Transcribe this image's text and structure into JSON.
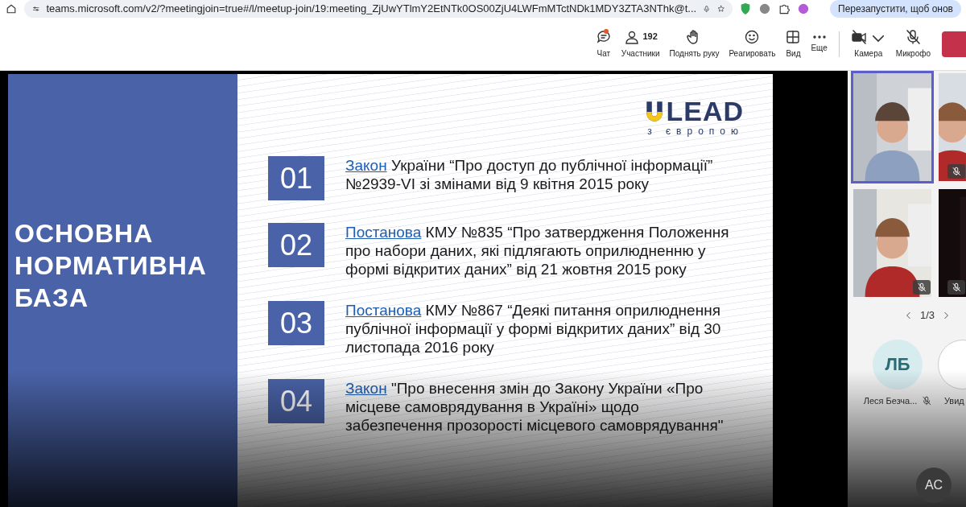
{
  "browser": {
    "url": "teams.microsoft.com/v2/?meetingjoin=true#/l/meetup-join/19:meeting_ZjUwYTlmY2EtNTk0OS00ZjU4LWFmMTctNDk1MDY3ZTA3NThk@t...",
    "restart_button": "Перезапустити, щоб онов"
  },
  "toolbar": {
    "buttons": [
      {
        "kind": "chat",
        "label": "Чат",
        "unread": true
      },
      {
        "kind": "people",
        "label": "Участники",
        "count": "192"
      },
      {
        "kind": "hand",
        "label": "Поднять руку"
      },
      {
        "kind": "react",
        "label": "Реагировать"
      },
      {
        "kind": "view",
        "label": "Вид"
      },
      {
        "kind": "more",
        "label": "Еще"
      },
      {
        "kind": "camera",
        "label": "Камера",
        "off": true
      },
      {
        "kind": "mic",
        "label": "Микрофо",
        "off": true
      }
    ]
  },
  "slide": {
    "title": "ОСНОВНА НОРМАТИВНА БАЗА",
    "logo": {
      "brand": "LEAD",
      "tagline": "з європою"
    },
    "items": [
      {
        "number": "01",
        "link": "Закон",
        "text": "України “Про доступ до публічної інформації” №2939-VI зі змінами від 9 квітня 2015 року"
      },
      {
        "number": "02",
        "link": "Постанова",
        "text": "КМУ №835 “Про затвердження Положення про набори даних, які підлягають оприлюдненню у формі відкритих даних” від 21 жовтня 2015 року"
      },
      {
        "number": "03",
        "link": "Постанова",
        "text": "КМУ №867 “Деякі питання оприлюднення публічної інформації у формі відкритих даних” від 30 листопада 2016 року"
      },
      {
        "number": "04",
        "link": "Закон",
        "text": "\"Про внесення змін до Закону України «Про місцеве самоврядування в Україні» щодо забезпечення прозорості місцевого самоврядування\""
      }
    ]
  },
  "participants": {
    "tiles": [
      {
        "speaking": true,
        "muted": false,
        "video": true
      },
      {
        "speaking": false,
        "muted": true,
        "video": true
      },
      {
        "speaking": false,
        "muted": true,
        "video": true
      },
      {
        "speaking": false,
        "muted": true,
        "video": false
      }
    ],
    "pager": "1/3",
    "people": [
      {
        "initials": "ЛБ",
        "name": "Леся Безча...",
        "muted": true
      },
      {
        "name": "Увид",
        "muted": false
      }
    ],
    "more_avatar": "АС"
  }
}
